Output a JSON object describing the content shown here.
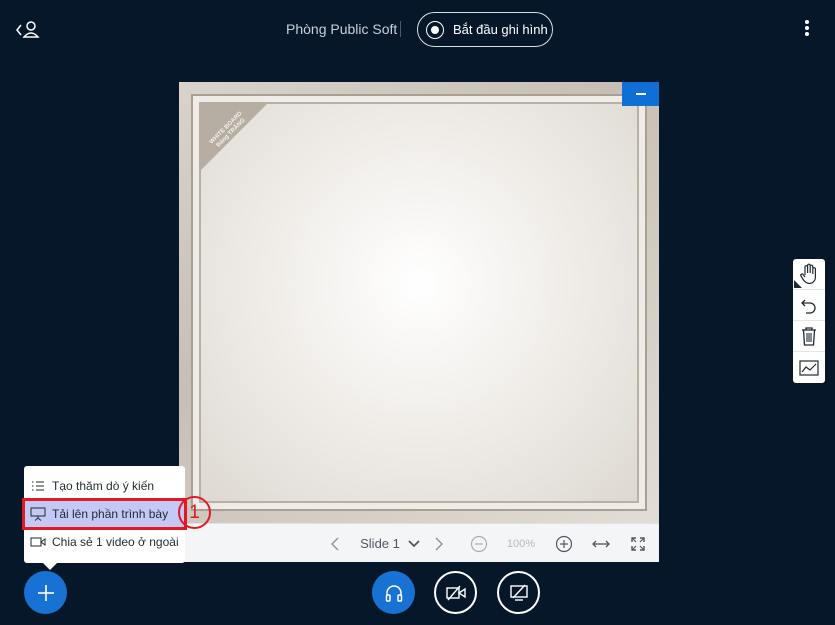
{
  "header": {
    "room_title": "Phòng Public Soft",
    "record_label": "Bắt đầu ghi hình"
  },
  "whiteboard": {
    "corner_text_line1": "WHITE BOARD",
    "corner_text_line2": "Bảng TRẮNG",
    "slide_label": "Slide 1",
    "zoom_level": "100%"
  },
  "menu": {
    "items": [
      {
        "label": "Tạo thăm dò ý kiến",
        "icon": "list-icon"
      },
      {
        "label": "Tải lên phần trình bày",
        "icon": "presentation-icon"
      },
      {
        "label": "Chia sẻ 1 video ở ngoài",
        "icon": "video-icon"
      }
    ],
    "step_marker": "1"
  },
  "colors": {
    "background": "#06172a",
    "accent": "#1872d4",
    "highlight": "#e01925"
  }
}
